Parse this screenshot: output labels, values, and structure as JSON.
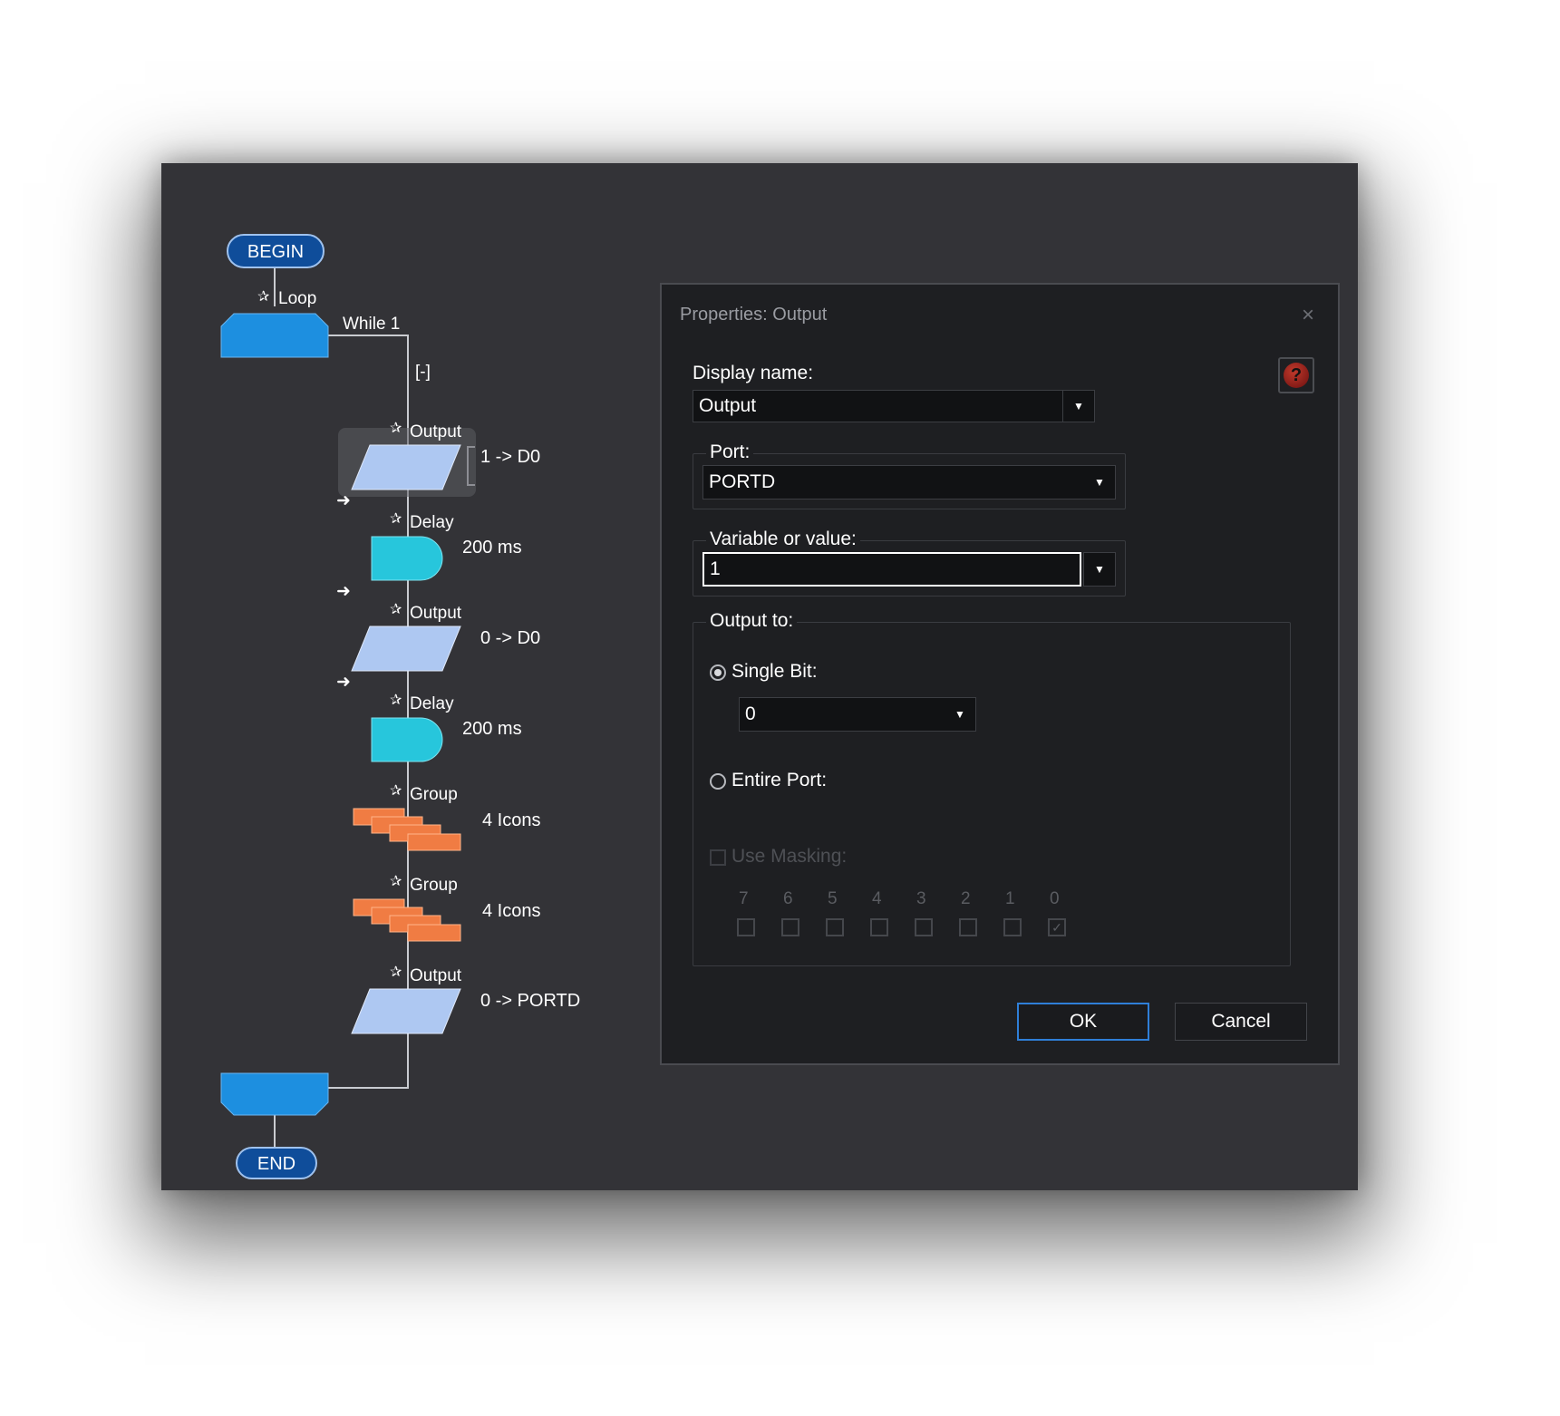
{
  "flowchart": {
    "begin": "BEGIN",
    "end": "END",
    "loop": {
      "label": "Loop",
      "condition": "While 1",
      "collapse": "[-]"
    },
    "icons": [
      {
        "type": "output",
        "label": "Output",
        "value": "1 -> D0"
      },
      {
        "type": "delay",
        "label": "Delay",
        "value": "200 ms"
      },
      {
        "type": "output",
        "label": "Output",
        "value": "0 -> D0"
      },
      {
        "type": "delay",
        "label": "Delay",
        "value": "200 ms"
      },
      {
        "type": "group",
        "label": "Group",
        "value": "4 Icons"
      },
      {
        "type": "group",
        "label": "Group",
        "value": "4 Icons"
      },
      {
        "type": "output",
        "label": "Output",
        "value": "0 -> PORTD"
      }
    ],
    "colors": {
      "loop": "#1d8fe0",
      "output": "#aec8f2",
      "delay": "#27c6dc",
      "group": "#f07c43",
      "terminal": "#0f4d9a"
    }
  },
  "dialog": {
    "title": "Properties: Output",
    "close": "×",
    "help": "?",
    "display_name_label": "Display name:",
    "display_name_value": "Output",
    "port_label": "Port:",
    "port_value": "PORTD",
    "variable_label": "Variable or value:",
    "variable_value": "1",
    "output_to_label": "Output to:",
    "single_bit_label": "Single Bit:",
    "single_bit_value": "0",
    "entire_port_label": "Entire Port:",
    "use_masking_label": "Use Masking:",
    "bits": [
      "7",
      "6",
      "5",
      "4",
      "3",
      "2",
      "1",
      "0"
    ],
    "ok": "OK",
    "cancel": "Cancel"
  }
}
